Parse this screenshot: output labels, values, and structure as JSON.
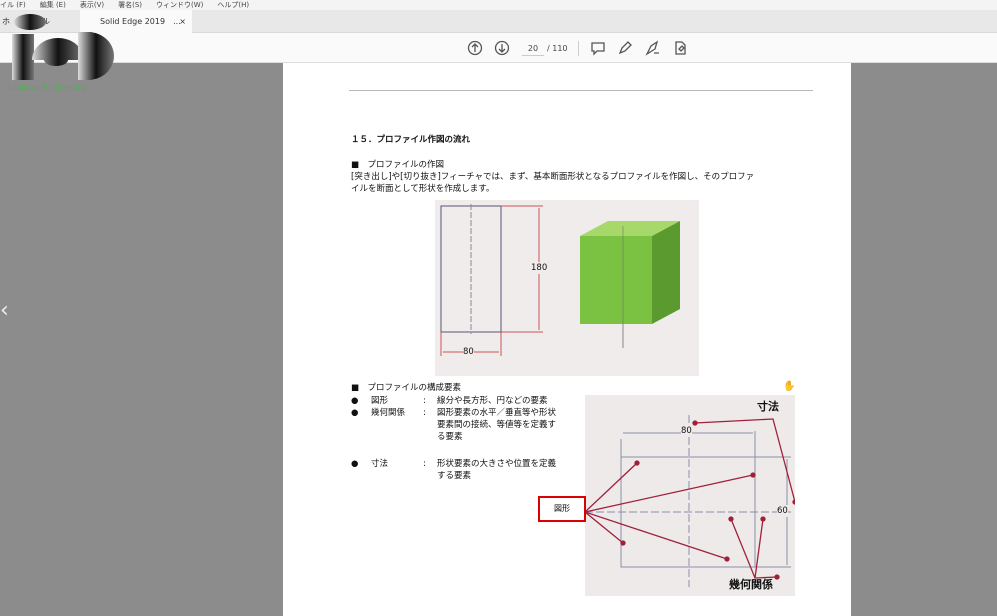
{
  "menu": [
    "イル (F)",
    "編集 (E)",
    "表示(V)",
    "署名(S)",
    "ウィンドウ(W)",
    "ヘルプ(H)"
  ],
  "tabs": [
    {
      "label": "ホ　　　ール"
    },
    {
      "label": "Solid Edge 2019　...",
      "close": "×"
    }
  ],
  "toolbar": {
    "page_current": "20",
    "page_total": "/ 110",
    "icons": [
      "prev-page-icon",
      "next-page-icon",
      "comment-icon",
      "pen-icon",
      "sign-icon",
      "stamp-icon"
    ]
  },
  "logo": {
    "text": "ie",
    "subtitle": "Ishikawa Engineering"
  },
  "document": {
    "heading": "１５．プロファイル作図の流れ",
    "section1_title": "■　プロファイルの作図",
    "section1_line1": "[突き出し]や[切り抜き]フィーチャでは、まず、基本断面形状となるプロファイルを作図し、そのプロファ",
    "section1_line2": "イルを断面として形状を作成します。",
    "fig1_dim_h": "180",
    "fig1_dim_w": "80",
    "section2_title": "■　プロファイルの構成要素",
    "items": [
      {
        "bullet": "●",
        "term": "図形",
        "colon": ":",
        "desc": [
          "線分や長方形、円などの要素"
        ]
      },
      {
        "bullet": "●",
        "term": "幾何関係",
        "colon": ":",
        "desc": [
          "図形要素の水平／垂直等や形状",
          "要素間の接続、等値等を定義す",
          "る要素"
        ]
      },
      {
        "bullet": "●",
        "term": "寸法",
        "colon": ":",
        "desc": [
          "形状要素の大きさや位置を定義",
          "する要素"
        ]
      }
    ],
    "fig2_label_dim": "寸法",
    "fig2_label_geo": "幾何関係",
    "fig2_dim_w": "80",
    "fig2_dim_h": "60",
    "callout": "図形"
  },
  "colors": {
    "callout_border": "#dd0000",
    "block_green": "#7cc242",
    "annotation": "#a0203a"
  }
}
